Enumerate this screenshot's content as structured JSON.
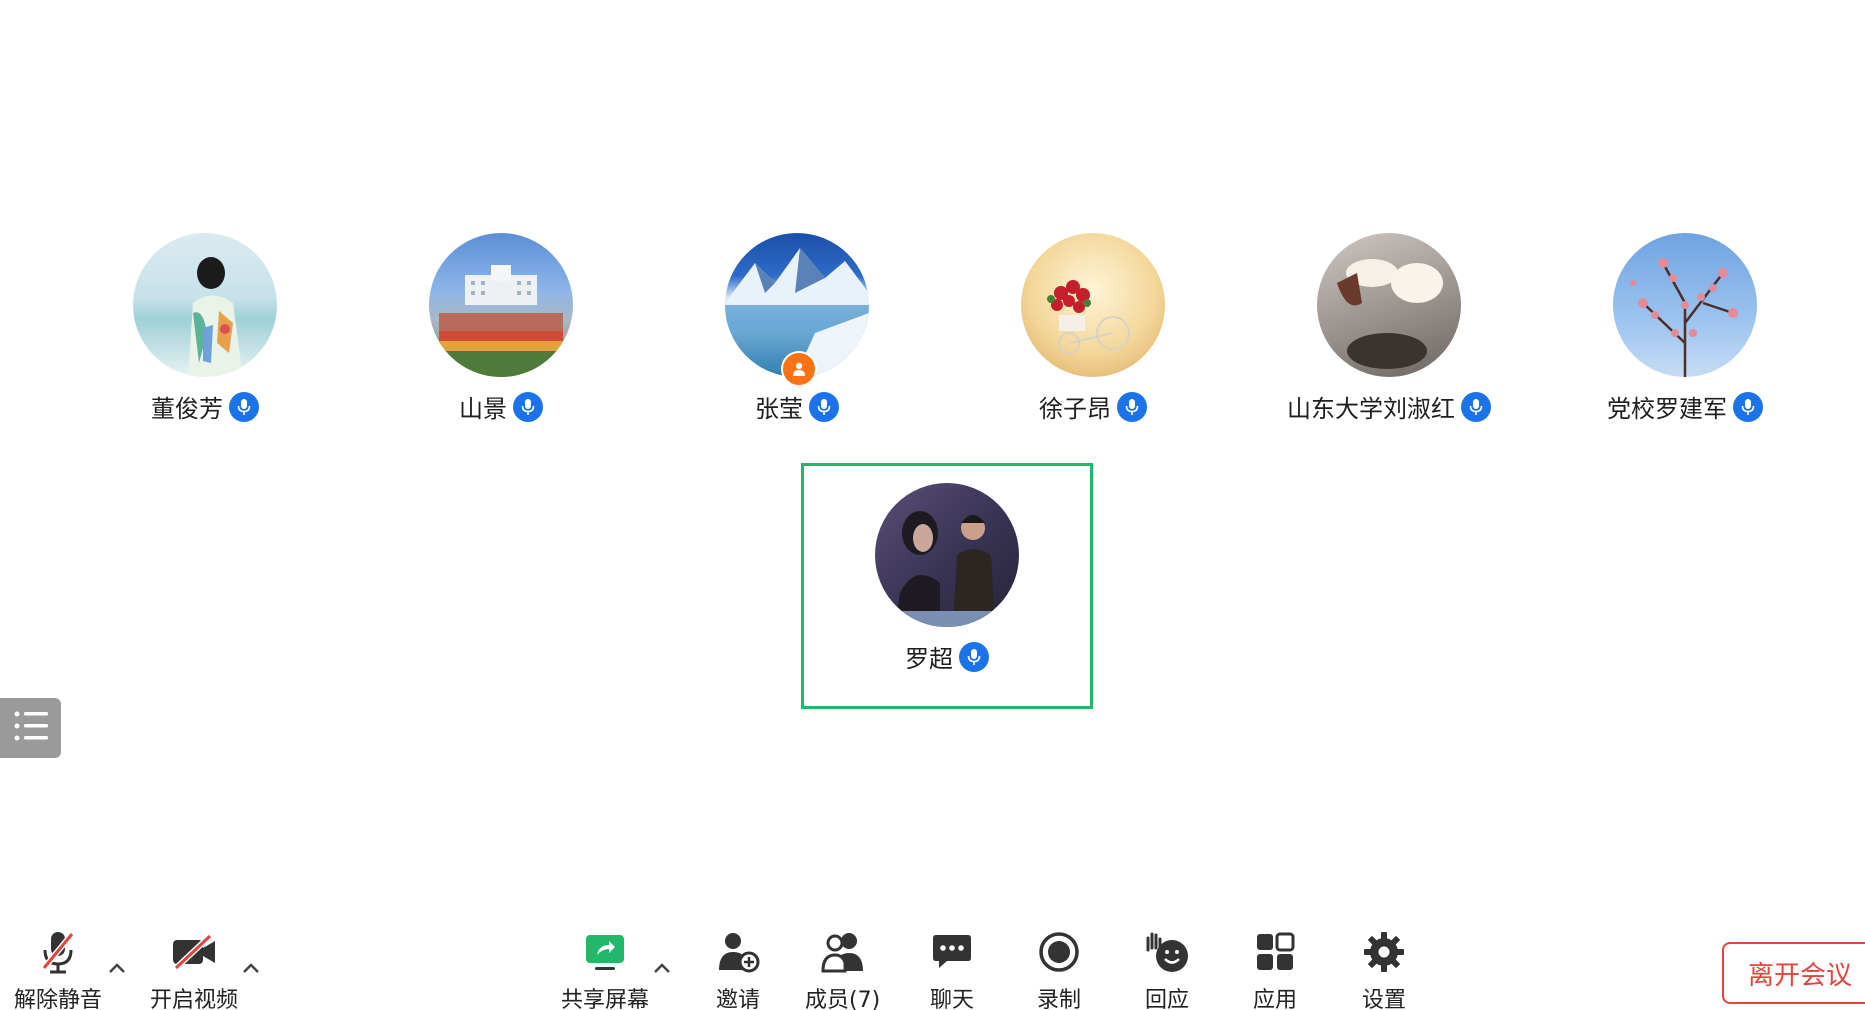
{
  "participants": [
    {
      "name": "董俊芳"
    },
    {
      "name": "山景"
    },
    {
      "name": "张莹"
    },
    {
      "name": "徐子昂"
    },
    {
      "name": "山东大学刘淑红"
    },
    {
      "name": "党校罗建军"
    },
    {
      "name": "罗超"
    }
  ],
  "toolbar": {
    "unmute_label": "解除静音",
    "start_video_label": "开启视频",
    "share_screen_label": "共享屏幕",
    "invite_label": "邀请",
    "members_label": "成员(7)",
    "chat_label": "聊天",
    "record_label": "录制",
    "reaction_label": "回应",
    "apps_label": "应用",
    "settings_label": "设置",
    "leave_label": "离开会议"
  },
  "colors": {
    "mic_badge": "#1a73e8",
    "speaking_frame": "#22b86a",
    "host_badge": "#f97316",
    "leave": "#e0463e",
    "share_screen": "#22b86a"
  },
  "icons": {
    "unmute": "mic-muted-icon",
    "start_video": "video-off-icon",
    "share_screen": "share-screen-icon",
    "invite": "add-user-icon",
    "members": "members-icon",
    "chat": "chat-icon",
    "record": "record-icon",
    "reaction": "reaction-icon",
    "apps": "apps-icon",
    "settings": "gear-icon",
    "side_list": "list-icon",
    "host": "host-icon",
    "mic": "mic-icon"
  }
}
